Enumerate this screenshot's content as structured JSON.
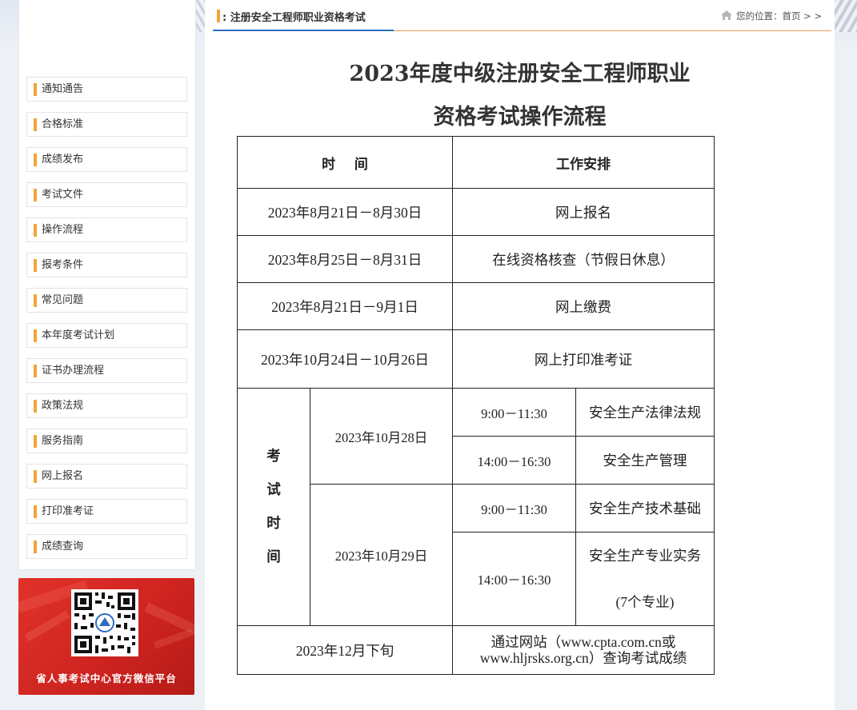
{
  "header": {
    "section_title": ": 注册安全工程师职业资格考试",
    "location_text": "您的位置：首页 > >"
  },
  "sidebar": {
    "items": [
      {
        "label": "通知通告"
      },
      {
        "label": "合格标准"
      },
      {
        "label": "成绩发布"
      },
      {
        "label": "考试文件"
      },
      {
        "label": "操作流程"
      },
      {
        "label": "报考条件"
      },
      {
        "label": "常见问题"
      },
      {
        "label": "本年度考试计划"
      },
      {
        "label": "证书办理流程"
      },
      {
        "label": "政策法规"
      },
      {
        "label": "服务指南"
      },
      {
        "label": "网上报名"
      },
      {
        "label": "打印准考证"
      },
      {
        "label": "成绩查询"
      }
    ],
    "qr_caption": "省人事考试中心官方微信平台"
  },
  "article": {
    "title_line1": "2023年度中级注册安全工程师职业",
    "title_line2": "资格考试操作流程"
  },
  "table": {
    "header_time": "时    间",
    "header_work": "工作安排",
    "rows": [
      {
        "time": "2023年8月21日－8月30日",
        "work": "网上报名"
      },
      {
        "time": "2023年8月25日－8月31日",
        "work": "在线资格核查（节假日休息）"
      },
      {
        "time": "2023年8月21日－9月1日",
        "work": "网上缴费"
      },
      {
        "time": "2023年10月24日－10月26日",
        "work": "网上打印准考证"
      }
    ],
    "exam_label_chars": [
      "考",
      "试",
      "时",
      "间"
    ],
    "exam_days": [
      {
        "date": "2023年10月28日",
        "sessions": [
          {
            "time": "9:00－11:30",
            "subject": "安全生产法律法规"
          },
          {
            "time": "14:00－16:30",
            "subject": "安全生产管理"
          }
        ]
      },
      {
        "date": "2023年10月29日",
        "sessions": [
          {
            "time": "9:00－11:30",
            "subject": "安全生产技术基础"
          },
          {
            "time": "14:00－16:30",
            "subject": "安全生产专业实务",
            "subject_note": "(7个专业)"
          }
        ]
      }
    ],
    "result": {
      "time": "2023年12月下旬",
      "work_line1": "通过网站（www.cpta.com.cn或",
      "work_line2": "www.hljrsks.org.cn）查询考试成绩"
    }
  },
  "colors": {
    "accent_orange": "#f5a33a",
    "accent_blue": "#2a6fc2",
    "qr_card_red": "#d7281f"
  }
}
